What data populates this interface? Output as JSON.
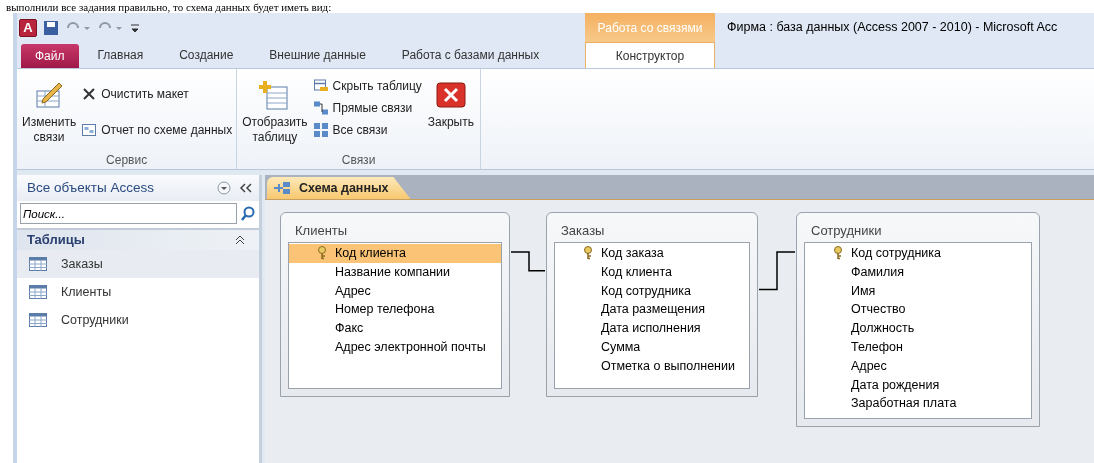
{
  "document_text": "выполнили все задания правильно, то схема данных будет иметь вид:",
  "window": {
    "app_logo": "A",
    "title": "Фирма : база данных (Access 2007 - 2010)  -  Microsoft Acc",
    "context_group": "Работа со связями"
  },
  "tabs": [
    {
      "label": "Файл",
      "kind": "file",
      "selected": false
    },
    {
      "label": "Главная",
      "kind": "normal",
      "selected": false
    },
    {
      "label": "Создание",
      "kind": "normal",
      "selected": false
    },
    {
      "label": "Внешние данные",
      "kind": "normal",
      "selected": false
    },
    {
      "label": "Работа с базами данных",
      "kind": "normal",
      "selected": false
    },
    {
      "label": "Конструктор",
      "kind": "context",
      "selected": true
    }
  ],
  "ribbon": [
    {
      "name": "Сервис",
      "buttons": [
        {
          "label": "Изменить связи",
          "kind": "large"
        },
        {
          "label": "Очистить макет",
          "kind": "small"
        },
        {
          "label": "Отчет по схеме данных",
          "kind": "small"
        }
      ]
    },
    {
      "name": "Связи",
      "buttons": [
        {
          "label": "Отобразить таблицу",
          "kind": "large"
        },
        {
          "label": "Скрыть таблицу",
          "kind": "small"
        },
        {
          "label": "Прямые связи",
          "kind": "small"
        },
        {
          "label": "Все связи",
          "kind": "small"
        },
        {
          "label": "Закрыть",
          "kind": "large"
        }
      ]
    }
  ],
  "navigation": {
    "title": "Все объекты Access",
    "search": {
      "placeholder": "Поиск..."
    },
    "group": "Таблицы",
    "items": [
      {
        "label": "Заказы",
        "selected": true
      },
      {
        "label": "Клиенты",
        "selected": false
      },
      {
        "label": "Сотрудники",
        "selected": false
      }
    ]
  },
  "document_tab": {
    "label": "Схема данных",
    "selected": true
  },
  "tables": [
    {
      "name": "Клиенты",
      "fields": [
        {
          "name": "Код клиента",
          "key": true,
          "selected": true
        },
        {
          "name": "Название компании",
          "key": false,
          "selected": false
        },
        {
          "name": "Адрес",
          "key": false,
          "selected": false
        },
        {
          "name": "Номер телефона",
          "key": false,
          "selected": false
        },
        {
          "name": "Факс",
          "key": false,
          "selected": false
        },
        {
          "name": "Адрес электронной почты",
          "key": false,
          "selected": false
        }
      ]
    },
    {
      "name": "Заказы",
      "fields": [
        {
          "name": "Код заказа",
          "key": true,
          "selected": false
        },
        {
          "name": "Код клиента",
          "key": false,
          "selected": false
        },
        {
          "name": "Код сотрудника",
          "key": false,
          "selected": false
        },
        {
          "name": "Дата размещения",
          "key": false,
          "selected": false
        },
        {
          "name": "Дата исполнения",
          "key": false,
          "selected": false
        },
        {
          "name": "Сумма",
          "key": false,
          "selected": false
        },
        {
          "name": "Отметка о выполнении",
          "key": false,
          "selected": false
        }
      ]
    },
    {
      "name": "Сотрудники",
      "fields": [
        {
          "name": "Код сотрудника",
          "key": true,
          "selected": false
        },
        {
          "name": "Фамилия",
          "key": false,
          "selected": false
        },
        {
          "name": "Имя",
          "key": false,
          "selected": false
        },
        {
          "name": "Отчество",
          "key": false,
          "selected": false
        },
        {
          "name": "Должность",
          "key": false,
          "selected": false
        },
        {
          "name": "Телефон",
          "key": false,
          "selected": false
        },
        {
          "name": "Адрес",
          "key": false,
          "selected": false
        },
        {
          "name": "Дата рождения",
          "key": false,
          "selected": false
        },
        {
          "name": "Заработная плата",
          "key": false,
          "selected": false
        }
      ]
    }
  ]
}
